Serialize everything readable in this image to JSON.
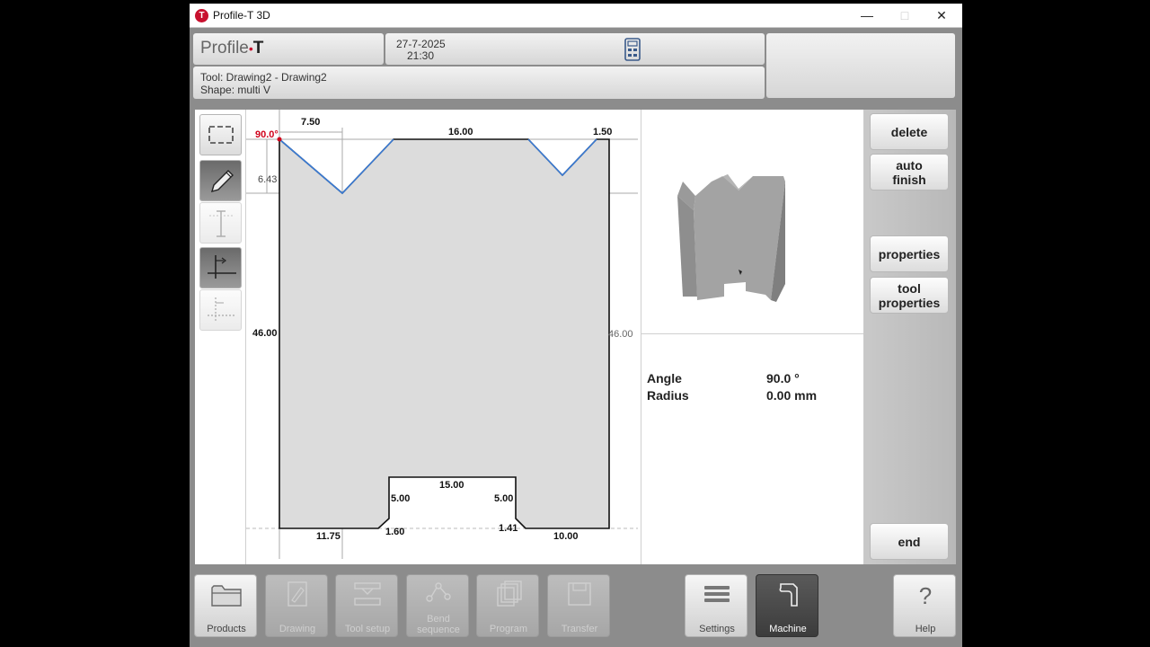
{
  "window": {
    "title": "Profile-T 3D",
    "app_icon_letter": "T",
    "minimize": "—",
    "maximize": "□",
    "close": "✕"
  },
  "header": {
    "brand_prefix": "Profile",
    "brand_dot": "•",
    "brand_suffix": "T",
    "date": "27-7-2025",
    "time": "21:30",
    "calculator_icon": "calculator-icon",
    "tool_line": "Tool: Drawing2 - Drawing2",
    "shape_line": "Shape: multi V"
  },
  "toolstrip": {
    "items": [
      {
        "name": "fit-view",
        "icon": "frame-icon",
        "active": false
      },
      {
        "name": "draw",
        "icon": "pencil-icon",
        "active": true
      },
      {
        "name": "dimension",
        "icon": "dimension-icon",
        "active": false
      },
      {
        "name": "axis",
        "icon": "axis-icon",
        "active": true
      },
      {
        "name": "axis-alt",
        "icon": "axis-dotted-icon",
        "active": false
      }
    ]
  },
  "drawing": {
    "angle_label": "90.0°",
    "dims": {
      "top_offset": "7.50",
      "top_middle": "16.00",
      "top_right": "1.50",
      "v_depth": "6.43",
      "height_left": "46.00",
      "height_right": "46.00",
      "slot_width": "15.00",
      "slot_left_height": "5.00",
      "slot_right_height": "5.00",
      "bottom_left": "11.75",
      "chamfer_left": "1.60",
      "chamfer_right": "1.41",
      "bottom_right": "10.00"
    },
    "colors": {
      "profile_fill": "#dcdcdc",
      "v_line": "#3a7bd5",
      "angle": "#d0021b"
    }
  },
  "properties": {
    "rows": [
      {
        "label": "Angle",
        "value": "90.0 °"
      },
      {
        "label": "Radius",
        "value": "0.00 mm"
      }
    ]
  },
  "side_buttons": {
    "delete": "delete",
    "auto_finish_1": "auto",
    "auto_finish_2": "finish",
    "properties": "properties",
    "tool_properties_1": "tool",
    "tool_properties_2": "properties",
    "end": "end"
  },
  "nav": {
    "products": "Products",
    "drawing": "Drawing",
    "tool_setup": "Tool setup",
    "bend_sequence_1": "Bend",
    "bend_sequence_2": "sequence",
    "program": "Program",
    "transfer": "Transfer",
    "settings": "Settings",
    "machine": "Machine",
    "help": "Help",
    "help_glyph": "?"
  }
}
